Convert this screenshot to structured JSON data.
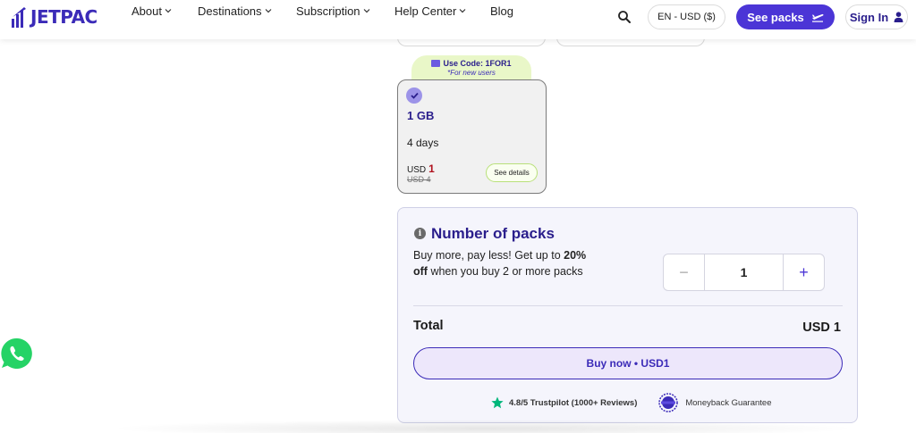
{
  "header": {
    "logo_text": "JETPAC",
    "nav": {
      "about": "About",
      "destinations": "Destinations",
      "subscription": "Subscription",
      "help_center": "Help Center",
      "blog": "Blog"
    },
    "language_currency": "EN - USD ($)",
    "see_packs": "See packs",
    "sign_in": "Sign In",
    "brand_color": "#3b2bb8",
    "accent_color": "#4b35d6"
  },
  "promo": {
    "code_text": "Use Code: 1FOR1",
    "subtext": "*For new users"
  },
  "selected_pack": {
    "data": "1 GB",
    "duration": "4 days",
    "currency": "USD",
    "price": "1",
    "original_price": "USD 4",
    "details_label": "See details",
    "selected": true
  },
  "packs_panel": {
    "title": "Number of packs",
    "desc_line1": "Buy more, pay less! Get up to",
    "desc_bold": "20% off",
    "desc_line2": " when you buy 2 or more packs",
    "quantity": "1",
    "minus_symbol": "−",
    "plus_symbol": "+",
    "total_label": "Total",
    "total_value": "USD 1",
    "buy_label": "Buy now • USD1",
    "trustpilot": "4.8/5 Trustpilot (1000+ Reviews)",
    "moneyback": "Moneyback Guarantee"
  },
  "icons": {
    "search": "search-icon",
    "plane": "plane-icon",
    "user": "user-icon",
    "info": "info-icon",
    "check": "check-icon",
    "star": "star-icon",
    "badge": "moneyback-badge-icon",
    "whatsapp": "whatsapp-icon"
  }
}
